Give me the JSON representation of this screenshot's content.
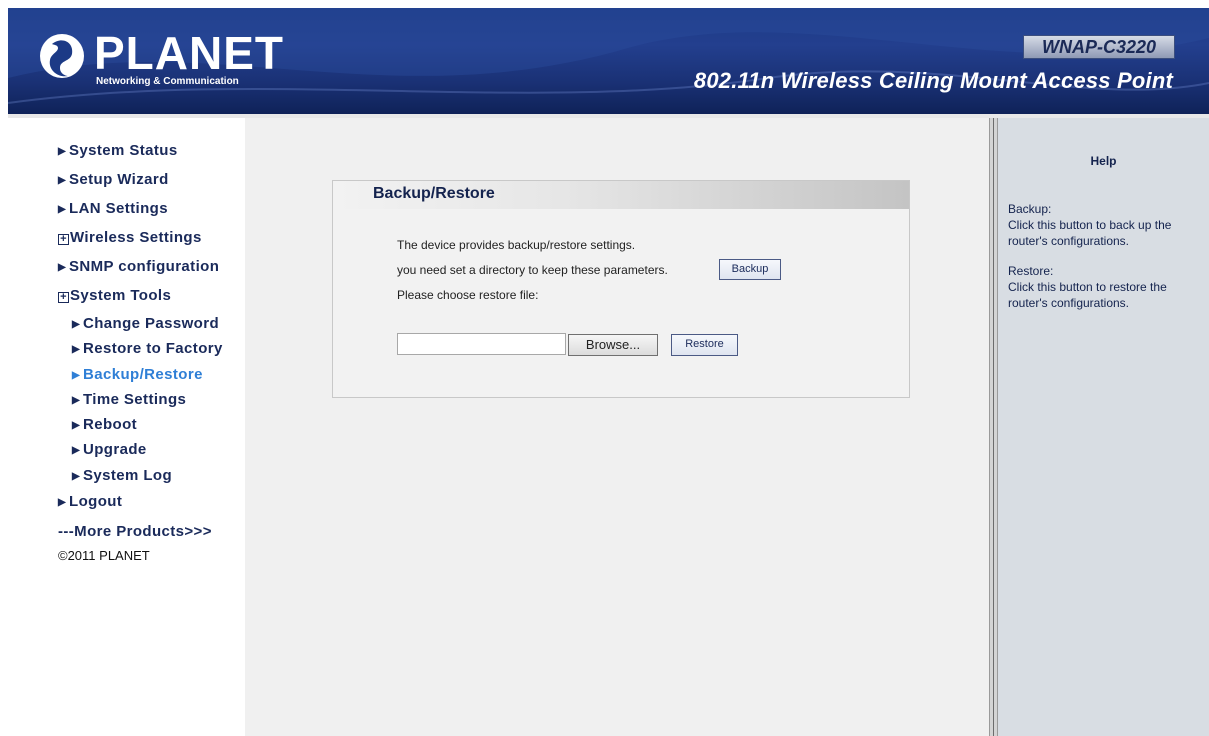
{
  "header": {
    "brand": "PLANET",
    "brand_sub": "Networking & Communication",
    "model": "WNAP-C3220",
    "product_title": "802.11n Wireless Ceiling Mount Access Point"
  },
  "sidebar": {
    "items": [
      {
        "label": "System Status",
        "marker": "bullet"
      },
      {
        "label": "Setup Wizard",
        "marker": "bullet"
      },
      {
        "label": "LAN Settings",
        "marker": "bullet"
      },
      {
        "label": "Wireless Settings",
        "marker": "plus"
      },
      {
        "label": "SNMP configuration",
        "marker": "bullet"
      },
      {
        "label": "System Tools",
        "marker": "plus"
      }
    ],
    "sub_items": [
      {
        "label": "Change Password"
      },
      {
        "label": "Restore to Factory"
      },
      {
        "label": "Backup/Restore",
        "active": true
      },
      {
        "label": "Time Settings"
      },
      {
        "label": "Reboot"
      },
      {
        "label": "Upgrade"
      },
      {
        "label": "System Log"
      }
    ],
    "logout": "Logout",
    "more_products": "---More Products>>>",
    "copyright": "©2011 PLANET"
  },
  "main": {
    "title": "Backup/Restore",
    "line1": "The device provides backup/restore settings.",
    "line2": "you need set a directory to keep these parameters.",
    "backup_button": "Backup",
    "line3": "Please choose restore file:",
    "file_value": "",
    "browse_button": "Browse...",
    "restore_button": "Restore"
  },
  "help": {
    "title": "Help",
    "backup_heading": "Backup:",
    "backup_text": "Click this button to back up the router's configurations.",
    "restore_heading": "Restore:",
    "restore_text": "Click this button to restore the router's configurations."
  },
  "colors": {
    "header_blue": "#1c3a86",
    "nav_text": "#1a2a5a",
    "nav_active": "#2f7fd6",
    "help_bg": "#d8dde3",
    "main_bg": "#f0f0f0"
  }
}
